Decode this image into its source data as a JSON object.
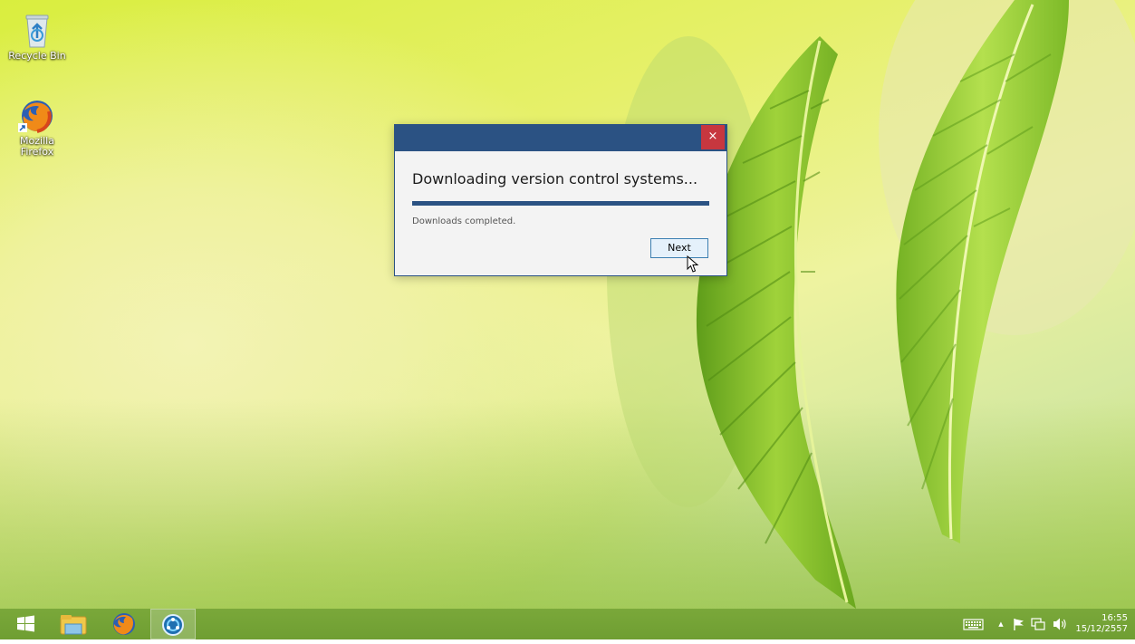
{
  "desktop": {
    "icons": [
      {
        "label": "Recycle Bin"
      },
      {
        "label": "Mozilla Firefox"
      }
    ]
  },
  "dialog": {
    "close_glyph": "×",
    "heading": "Downloading version control systems...",
    "progress": 1.0,
    "status": "Downloads completed.",
    "next_label": "Next"
  },
  "taskbar": {
    "apps": [
      "start-icon",
      "file-explorer-icon",
      "firefox-icon",
      "app-icon"
    ],
    "tray": {
      "expand_glyph": "▲",
      "time": "16:55",
      "date": "15/12/2557"
    }
  },
  "colors": {
    "titlebar": "#2b5283",
    "close": "#c7373f",
    "taskbar": "#75a336"
  }
}
